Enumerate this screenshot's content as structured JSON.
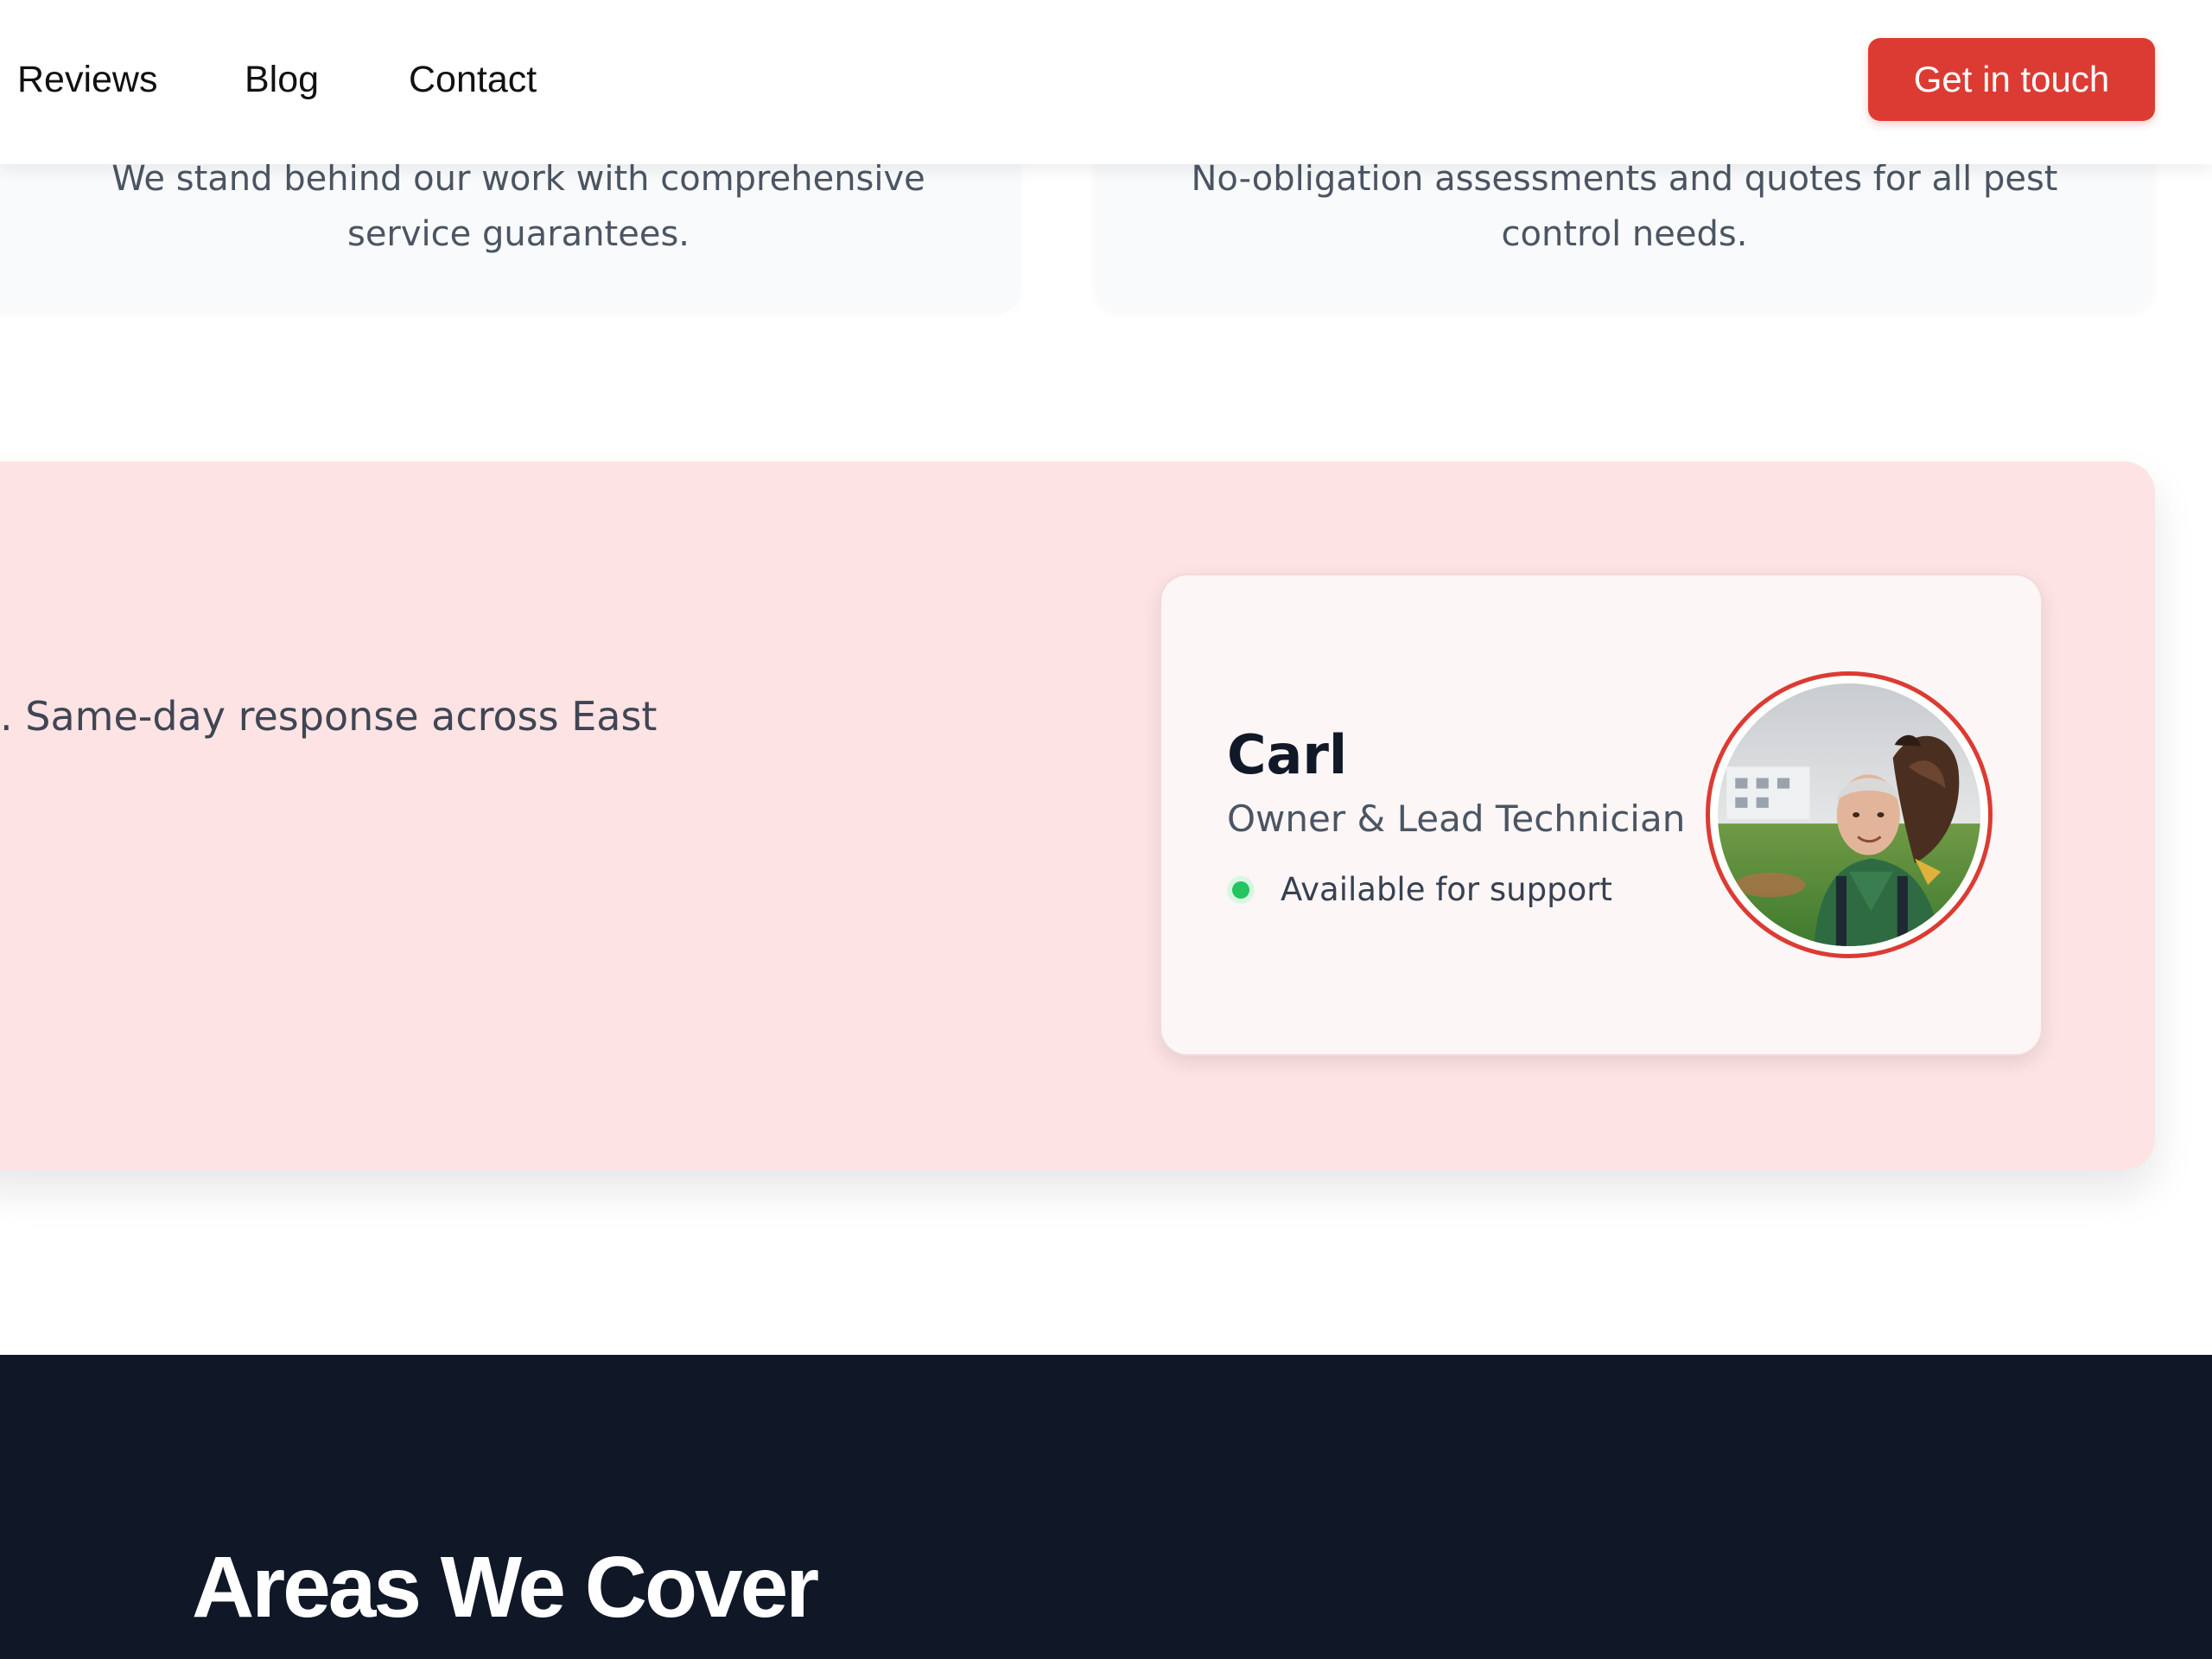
{
  "nav": {
    "links": [
      {
        "label": "Reviews"
      },
      {
        "label": "Blog"
      },
      {
        "label": "Contact"
      }
    ],
    "cta_label": "Get in touch"
  },
  "features": [
    {
      "description": "We stand behind our work with comprehensive service guarantees."
    },
    {
      "description": "No-obligation assessments and quotes for all pest control needs."
    }
  ],
  "support": {
    "text": ". Same-day response across East",
    "person": {
      "name": "Carl",
      "role": "Owner & Lead Technician",
      "status": "Available for support"
    }
  },
  "areas": {
    "title": "Areas We Cover"
  },
  "colors": {
    "accent": "#dc3b33",
    "support_band": "#fde3e3",
    "dark_section": "#101827",
    "status_online": "#22c55e"
  }
}
